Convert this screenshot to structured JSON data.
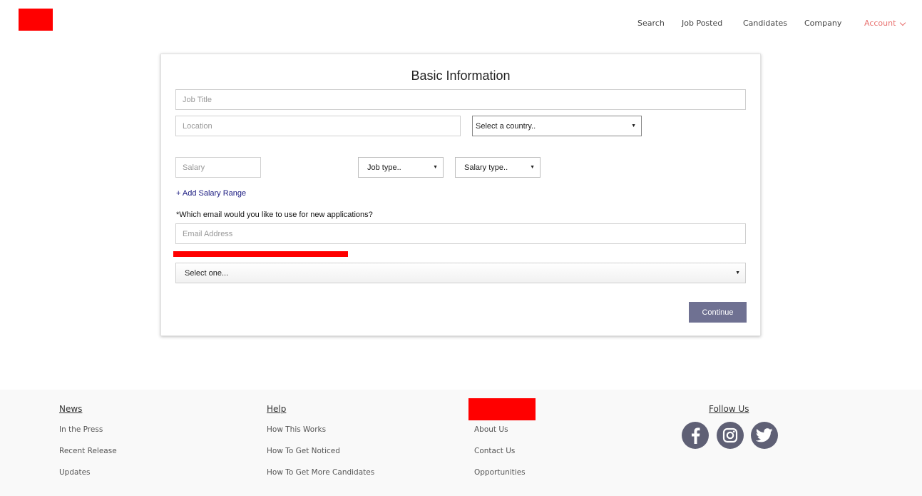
{
  "header": {
    "nav": {
      "search": "Search",
      "job_posted": "Job Posted",
      "candidates": "Candidates",
      "company": "Company",
      "account": "Account"
    }
  },
  "form": {
    "title": "Basic Information",
    "job_title_placeholder": "Job Title",
    "location_placeholder": "Location",
    "country_select": "Select a country..",
    "salary_placeholder": "Salary",
    "job_type_select": "Job type..",
    "salary_type_select": "Salary type..",
    "add_salary_range": "+ Add Salary Range",
    "email_question": "*Which email would you like to use for new applications?",
    "email_placeholder": "Email Address",
    "select_one": "Select one...",
    "continue_label": "Continue"
  },
  "footer": {
    "news": {
      "heading": "News",
      "links": [
        "In the Press",
        "Recent Release",
        "Updates"
      ]
    },
    "help": {
      "heading": "Help",
      "links": [
        "How This Works",
        "How To Get Noticed",
        "How To Get More Candidates"
      ]
    },
    "company": {
      "links": [
        "About Us",
        "Contact Us",
        "Opportunities"
      ]
    },
    "follow": {
      "heading": "Follow Us",
      "icons": [
        "facebook-icon",
        "instagram-icon",
        "twitter-icon"
      ]
    }
  },
  "colors": {
    "accent": "#e8706e",
    "redaction": "#ff0000",
    "button": "#6f7192",
    "social": "#5f6075",
    "link": "#1a1a80"
  }
}
